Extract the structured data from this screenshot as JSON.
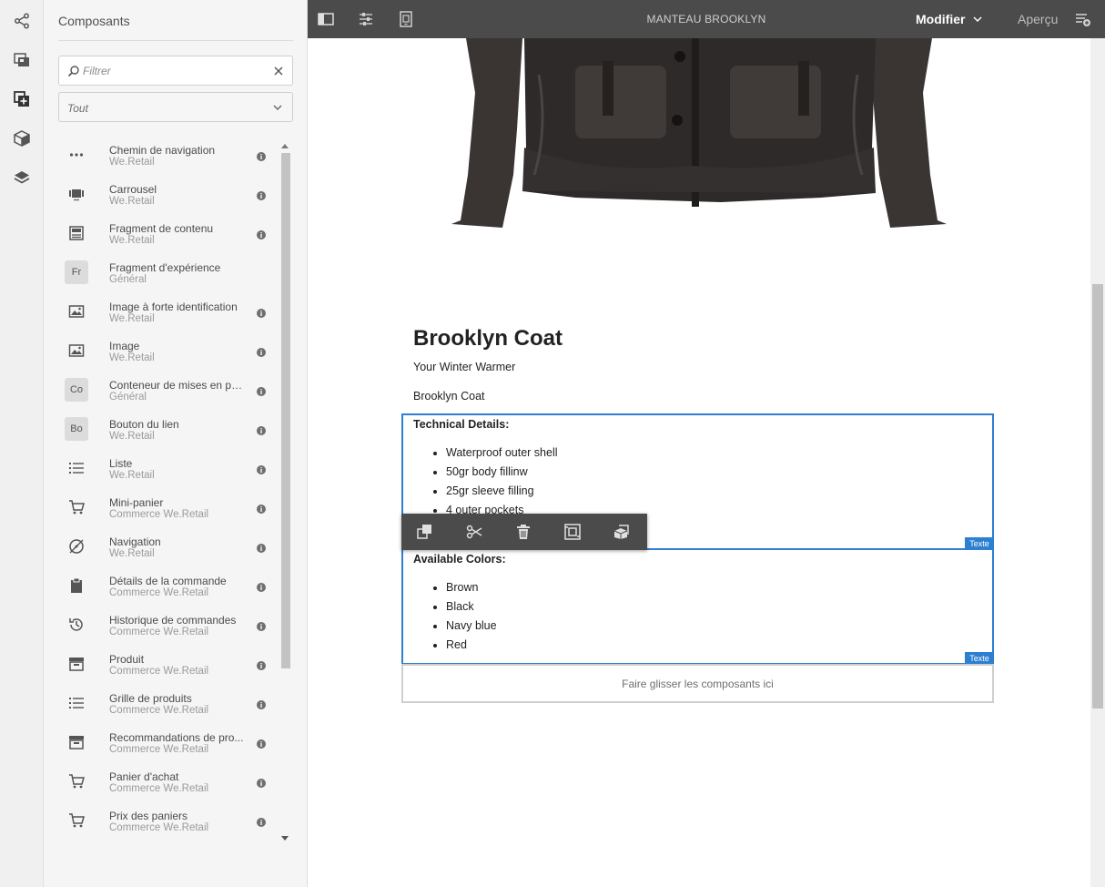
{
  "rail": {
    "items": [
      {
        "icon": "share-icon"
      },
      {
        "icon": "assets-icon"
      },
      {
        "icon": "components-icon"
      },
      {
        "icon": "content-tree-icon"
      },
      {
        "icon": "layers-icon"
      }
    ]
  },
  "panel": {
    "title": "Composants",
    "search": {
      "placeholder": "Filtrer",
      "value": ""
    },
    "filter": {
      "selected": "Tout"
    },
    "items": [
      {
        "name": "Chemin de navigation",
        "group": "We.Retail",
        "icon": "ellipsis-icon"
      },
      {
        "name": "Carrousel",
        "group": "We.Retail",
        "icon": "carousel-icon"
      },
      {
        "name": "Fragment de contenu",
        "group": "We.Retail",
        "icon": "content-fragment-icon"
      },
      {
        "name": "Fragment d'expérience",
        "group": "Général",
        "abbr": "Fr"
      },
      {
        "name": "Image à forte identification",
        "group": "We.Retail",
        "icon": "image-icon"
      },
      {
        "name": "Image",
        "group": "We.Retail",
        "icon": "image-icon"
      },
      {
        "name": "Conteneur de mises en page",
        "group": "Général",
        "abbr": "Co"
      },
      {
        "name": "Bouton du lien",
        "group": "We.Retail",
        "abbr": "Bo"
      },
      {
        "name": "Liste",
        "group": "We.Retail",
        "icon": "list-icon"
      },
      {
        "name": "Mini-panier",
        "group": "Commerce We.Retail",
        "icon": "cart-icon"
      },
      {
        "name": "Navigation",
        "group": "We.Retail",
        "icon": "compass-icon"
      },
      {
        "name": "Détails de la commande",
        "group": "Commerce We.Retail",
        "icon": "clipboard-icon"
      },
      {
        "name": "Historique de commandes",
        "group": "Commerce We.Retail",
        "icon": "history-icon"
      },
      {
        "name": "Produit",
        "group": "Commerce We.Retail",
        "icon": "archive-icon"
      },
      {
        "name": "Grille de produits",
        "group": "Commerce We.Retail",
        "icon": "list-icon"
      },
      {
        "name": "Recommandations de pro...",
        "group": "Commerce We.Retail",
        "icon": "archive-icon"
      },
      {
        "name": "Panier d'achat",
        "group": "Commerce We.Retail",
        "icon": "cart-icon"
      },
      {
        "name": "Prix des paniers",
        "group": "Commerce We.Retail",
        "icon": "cart-icon"
      }
    ]
  },
  "topbar": {
    "title": "MANTEAU BROOKLYN",
    "mode": "Modifier",
    "preview": "Aperçu"
  },
  "page": {
    "heading": "Brooklyn Coat",
    "subtitle": "Your Winter Warmer",
    "name": "Brooklyn Coat",
    "technical": {
      "title": "Technical Details:",
      "items": [
        "Waterproof outer shell",
        "50gr body fillinw",
        "25gr sleeve filling",
        "4 outer pockets"
      ],
      "tag": "Texte"
    },
    "colors": {
      "title": "Available Colors:",
      "items": [
        "Brown",
        "Black",
        "Navy blue",
        "Red"
      ],
      "tag": "Texte"
    },
    "dropzone": "Faire glisser les composants ici"
  },
  "colors": {
    "selection": "#2d7fd1",
    "topbar": "#4b4b4b"
  }
}
